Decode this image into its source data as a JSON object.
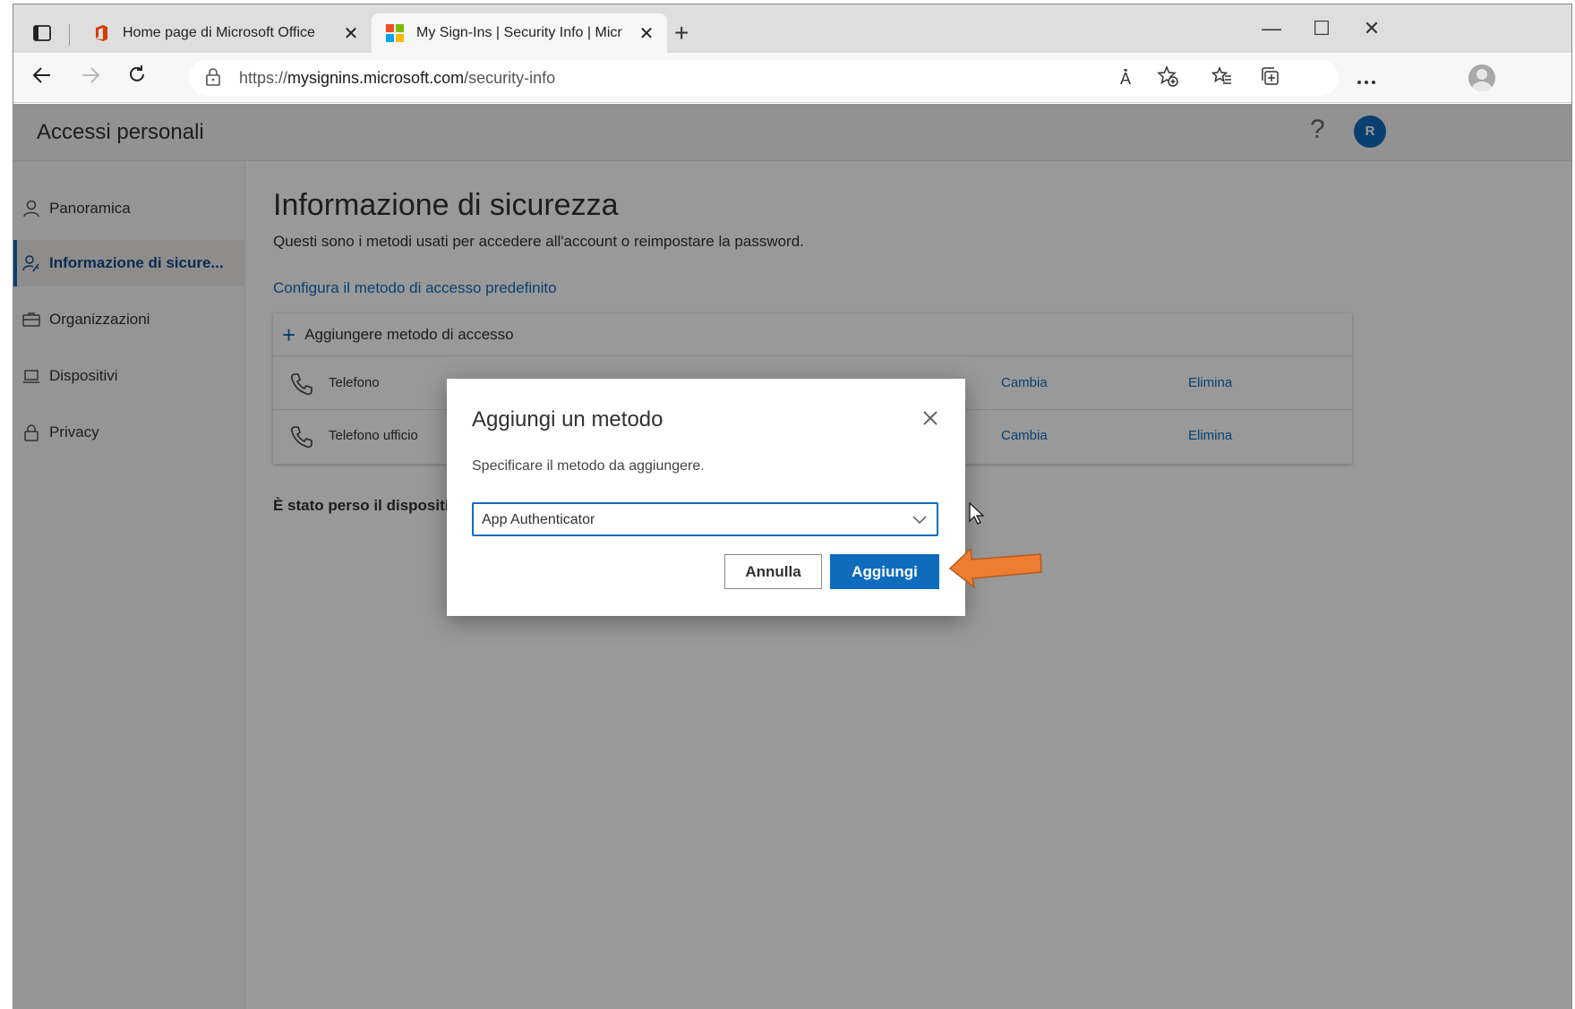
{
  "browser": {
    "tabs": [
      {
        "title": "Home page di Microsoft Office",
        "close": "✕"
      },
      {
        "title": "My Sign-Ins | Security Info | Micr",
        "close": "✕"
      }
    ],
    "new_tab": "+",
    "url_scheme": "https://",
    "url_host": "mysignins.microsoft.com",
    "url_path": "/security-info",
    "window_controls": {
      "minimize": "—",
      "maximize": "☐",
      "close": "✕"
    },
    "toolbar_icons": [
      "read-aloud-icon",
      "add-favorite-icon",
      "favorites-icon",
      "collections-icon",
      "profile-icon",
      "more-icon"
    ],
    "read_aloud_glyph": "À̉"
  },
  "header": {
    "title": "Accessi personali",
    "help": "?",
    "avatar_initial": "R",
    "avatar_color": "#0f6cbd"
  },
  "sidebar": {
    "items": [
      {
        "label": "Panoramica",
        "icon": "person-icon"
      },
      {
        "label": "Informazione di sicure...",
        "icon": "security-info-icon",
        "active": true
      },
      {
        "label": "Organizzazioni",
        "icon": "briefcase-icon"
      },
      {
        "label": "Dispositivi",
        "icon": "laptop-icon"
      },
      {
        "label": "Privacy",
        "icon": "lock-icon"
      }
    ]
  },
  "main": {
    "title": "Informazione di sicurezza",
    "description": "Questi sono i metodi usati per accedere all'account o reimpostare la password.",
    "default_method_link": "Configura il metodo di accesso predefinito",
    "add_method": "Aggiungere metodo di accesso",
    "methods": [
      {
        "name": "Telefono",
        "change": "Cambia",
        "delete": "Elimina"
      },
      {
        "name": "Telefono ufficio",
        "change": "Cambia",
        "delete": "Elimina"
      }
    ],
    "lost_device": "È stato perso il dispositivo"
  },
  "dialog": {
    "title": "Aggiungi un metodo",
    "subtitle": "Specificare il metodo da aggiungere.",
    "selected_method": "App Authenticator",
    "cancel_label": "Annulla",
    "add_label": "Aggiungi"
  },
  "annotation": {
    "arrow_color": "#ed7d31"
  }
}
